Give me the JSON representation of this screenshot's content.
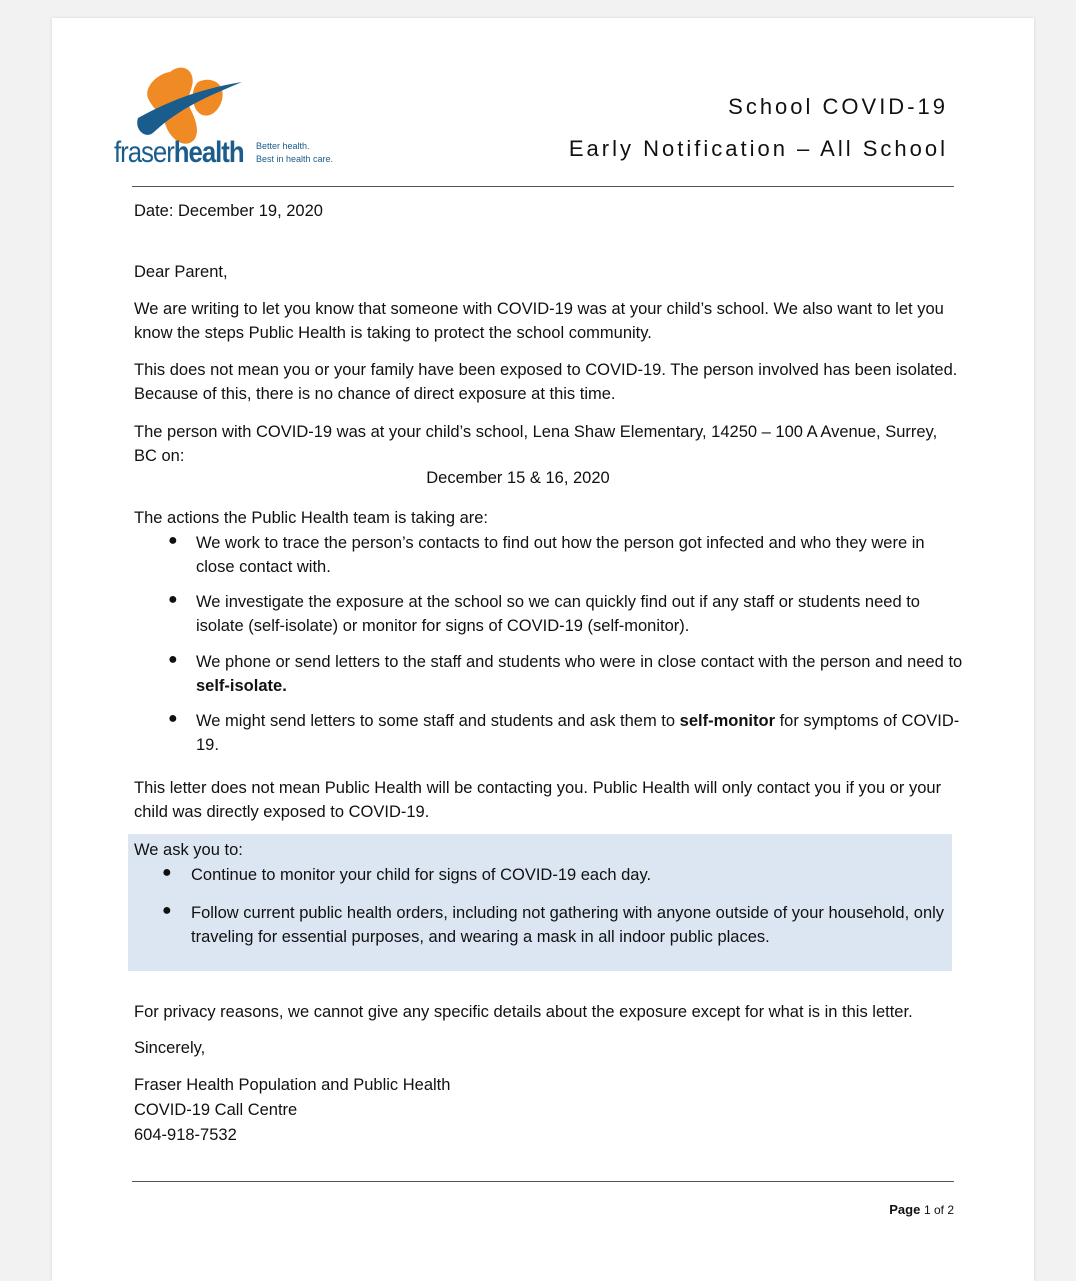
{
  "org": {
    "name_light": "fraser",
    "name_bold": "health",
    "tagline_1": "Better health.",
    "tagline_2": "Best in health care."
  },
  "header": {
    "title": "School COVID-19",
    "subtitle": "Early Notification – All School"
  },
  "letter": {
    "date": "Date: December 19, 2020",
    "greeting": "Dear Parent,",
    "p1": "We are writing to let you know that someone with COVID-19 was at your child’s school. We also want to let you know the steps Public Health is taking to protect the school community.",
    "p2": "This does not mean you or your family have been exposed to COVID-19. The person involved has been isolated. Because of this, there is no chance of direct exposure at this time.",
    "p3": "The person with COVID-19 was at your child’s school, Lena Shaw Elementary, 14250 – 100 A Avenue, Surrey, BC on:",
    "exposure_dates": "December 15 & 16, 2020",
    "actions_intro": "The actions the Public Health team is taking are:",
    "actions": [
      {
        "text": "We work to trace the person’s contacts to find out how the person got infected and who they were in close contact with."
      },
      {
        "text": "We investigate the exposure at the school so we can quickly find out if any staff or students need to isolate (self-isolate) or monitor for signs of COVID-19 (self-monitor)."
      },
      {
        "pre": "We phone or send letters to the staff and students who were in close contact with the person and need to ",
        "bold": "self-isolate.",
        "post": ""
      },
      {
        "pre": "We might send letters to some staff and students and ask them to ",
        "bold": "self-monitor",
        "post": " for symptoms of COVID-19."
      }
    ],
    "p4": "This letter does not mean Public Health will be contacting you. Public Health will only contact you if you or your child was directly exposed to COVID-19.",
    "ask_intro": "We ask you to:",
    "asks": [
      "Continue to monitor your child for signs of COVID-19 each day.",
      "Follow current public health orders, including not gathering with anyone outside of your household, only traveling for essential purposes, and wearing a mask in all indoor public places."
    ],
    "privacy": "For privacy reasons, we cannot give any specific details about the exposure except for what is in this letter.",
    "closing": "Sincerely,",
    "signature": [
      "Fraser Health Population and Public Health",
      "COVID-19 Call Centre",
      "604-918-7532"
    ]
  },
  "footer": {
    "page_label": "Page",
    "page_num": "1 of 2"
  },
  "colors": {
    "brand_blue": "#1a5d8c",
    "brand_orange": "#f08a24",
    "highlight_box": "#dce6f3"
  }
}
